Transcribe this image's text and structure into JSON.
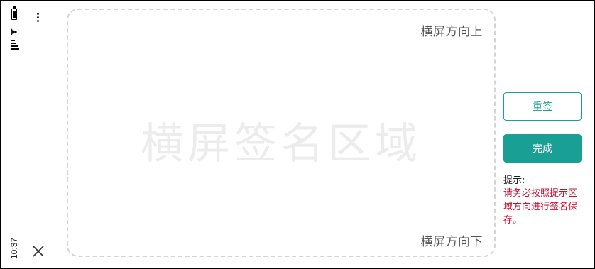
{
  "status": {
    "time": "10:37"
  },
  "sign_area": {
    "watermark": "横屏签名区域",
    "hint_top": "横屏方向上",
    "hint_bottom": "横屏方向下"
  },
  "actions": {
    "resign_label": "重签",
    "done_label": "完成"
  },
  "tips": {
    "label": "提示:",
    "text": "请务必按照提示区域方向进行签名保存。"
  },
  "colors": {
    "accent": "#1a9f94",
    "warning": "#c8102e",
    "border_dashed": "#d4d4d4"
  },
  "icons": [
    "battery-icon",
    "wifi-icon",
    "signal-icon",
    "more-vert-icon",
    "close-icon"
  ]
}
